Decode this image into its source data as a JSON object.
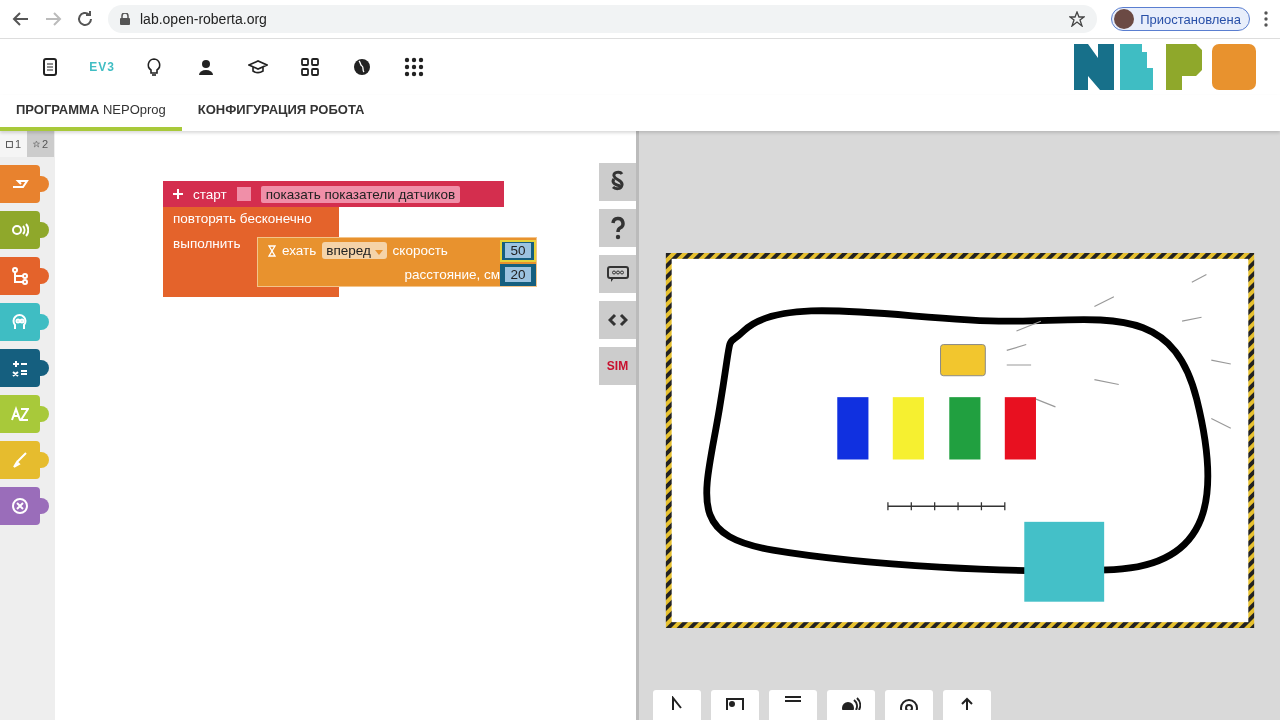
{
  "browser": {
    "url": "lab.open-roberta.org",
    "profile_label": "Приостановлена"
  },
  "menu": {
    "items": [
      {
        "kind": "doc"
      },
      {
        "kind": "robot",
        "label": "EV3"
      },
      {
        "kind": "bulb"
      },
      {
        "kind": "user"
      },
      {
        "kind": "cap"
      },
      {
        "kind": "grid"
      },
      {
        "kind": "globe"
      },
      {
        "kind": "dots"
      }
    ]
  },
  "tabs": [
    {
      "label": "**ПРОГРАММА** NEPOprog",
      "selected": true
    },
    {
      "label": "КОНФИГУРАЦИЯ РОБОТА",
      "selected": false
    }
  ],
  "toolbox": {
    "levels": [
      {
        "kind": "square",
        "label": "1",
        "selected": true
      },
      {
        "kind": "star",
        "label": "2",
        "selected": false
      }
    ],
    "categories": [
      {
        "kind": "action",
        "color": "#e8822e"
      },
      {
        "kind": "sensor",
        "color": "#8fa82b"
      },
      {
        "kind": "control",
        "color": "#e4632b"
      },
      {
        "kind": "logic",
        "color": "#3fbdc3"
      },
      {
        "kind": "math",
        "color": "#155f7f"
      },
      {
        "kind": "text",
        "color": "#a8c93a"
      },
      {
        "kind": "color",
        "color": "#e6bc2e"
      },
      {
        "kind": "messages",
        "color": "#9a6dba"
      }
    ]
  },
  "program": {
    "start": {
      "label": "старт",
      "show_sensors": {
        "label": "показать показатели датчиков",
        "checked": false
      }
    },
    "loop": {
      "label": "повторять бесконечно",
      "do_label": "выполнить"
    },
    "drive": {
      "label": "ехать",
      "direction": "вперед",
      "speed_label": "скорость",
      "speed": "50",
      "distance_label": "расстояние, см",
      "distance": "20"
    }
  },
  "side_buttons": [
    {
      "kind": "rules"
    },
    {
      "kind": "help"
    },
    {
      "kind": "comment"
    },
    {
      "kind": "code"
    },
    {
      "kind": "sim",
      "label": "SIM"
    }
  ],
  "sim_buttons": [
    {
      "kind": "pointer"
    },
    {
      "kind": "image"
    },
    {
      "kind": "screen"
    },
    {
      "kind": "sound"
    },
    {
      "kind": "target"
    },
    {
      "kind": "upload"
    }
  ]
}
